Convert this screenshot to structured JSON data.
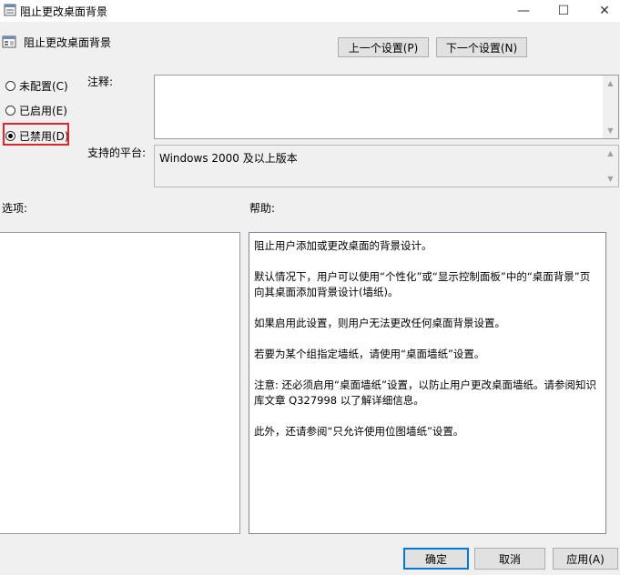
{
  "window": {
    "title": "阻止更改桌面背景",
    "minimize": "—",
    "maximize": "☐",
    "close": "✕"
  },
  "header": {
    "policy_name": "阻止更改桌面背景",
    "prev_button": "上一个设置(P)",
    "next_button": "下一个设置(N)"
  },
  "state": {
    "options": [
      {
        "label": "未配置(C)",
        "selected": false
      },
      {
        "label": "已启用(E)",
        "selected": false
      },
      {
        "label": "已禁用(D)",
        "selected": true
      }
    ]
  },
  "comment": {
    "label": "注释:",
    "value": ""
  },
  "platform": {
    "label": "支持的平台:",
    "value": "Windows 2000 及以上版本"
  },
  "options_panel": {
    "label": "选项:"
  },
  "help_panel": {
    "label": "帮助:",
    "paragraphs": [
      "阻止用户添加或更改桌面的背景设计。",
      "默认情况下，用户可以使用“个性化”或“显示控制面板”中的“桌面背景”页向其桌面添加背景设计(墙纸)。",
      "如果启用此设置，则用户无法更改任何桌面背景设置。",
      "若要为某个组指定墙纸，请使用“桌面墙纸”设置。",
      "注意: 还必须启用“桌面墙纸”设置，以防止用户更改桌面墙纸。请参阅知识库文章 Q327998 以了解详细信息。",
      "此外，还请参阅“只允许使用位图墙纸”设置。"
    ]
  },
  "footer": {
    "ok": "确定",
    "cancel": "取消",
    "apply": "应用(A)"
  },
  "colors": {
    "highlight": "#e0262a",
    "accent": "#0078d7"
  }
}
